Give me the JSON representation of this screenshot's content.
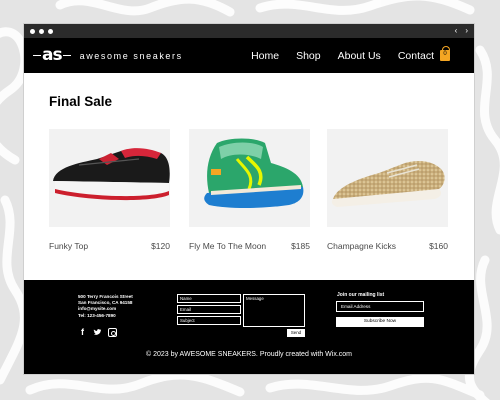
{
  "window": {
    "nav_arrows": [
      "‹",
      "›"
    ]
  },
  "header": {
    "logo": "as",
    "brand": "awesome sneakers",
    "nav": [
      "Home",
      "Shop",
      "About Us",
      "Contact"
    ],
    "cart_count": "0"
  },
  "main": {
    "title": "Final Sale",
    "products": [
      {
        "name": "Funky Top",
        "price": "$120"
      },
      {
        "name": "Fly Me To The Moon",
        "price": "$185"
      },
      {
        "name": "Champagne Kicks",
        "price": "$160"
      }
    ]
  },
  "footer": {
    "address": [
      "500 Terry Francois Street",
      "San Francisco, CA 94158",
      "info@mysite.com",
      "Tel: 123-456-7890"
    ],
    "social": [
      "facebook-icon",
      "twitter-icon",
      "instagram-icon"
    ],
    "form": {
      "name_placeholder": "Name",
      "email_placeholder": "Email",
      "subject_placeholder": "Subject",
      "message_placeholder": "Message",
      "send_label": "Send"
    },
    "mailing": {
      "title": "Join our mailing list",
      "email_placeholder": "Email Address",
      "subscribe_label": "Subscribe Now"
    },
    "copyright": "© 2023 by AWESOME SNEAKERS. Proudly created with Wix.com"
  },
  "colors": {
    "header_bg": "#000000",
    "accent_bag": "#f5a623",
    "card_bg": "#f2f2f2"
  }
}
